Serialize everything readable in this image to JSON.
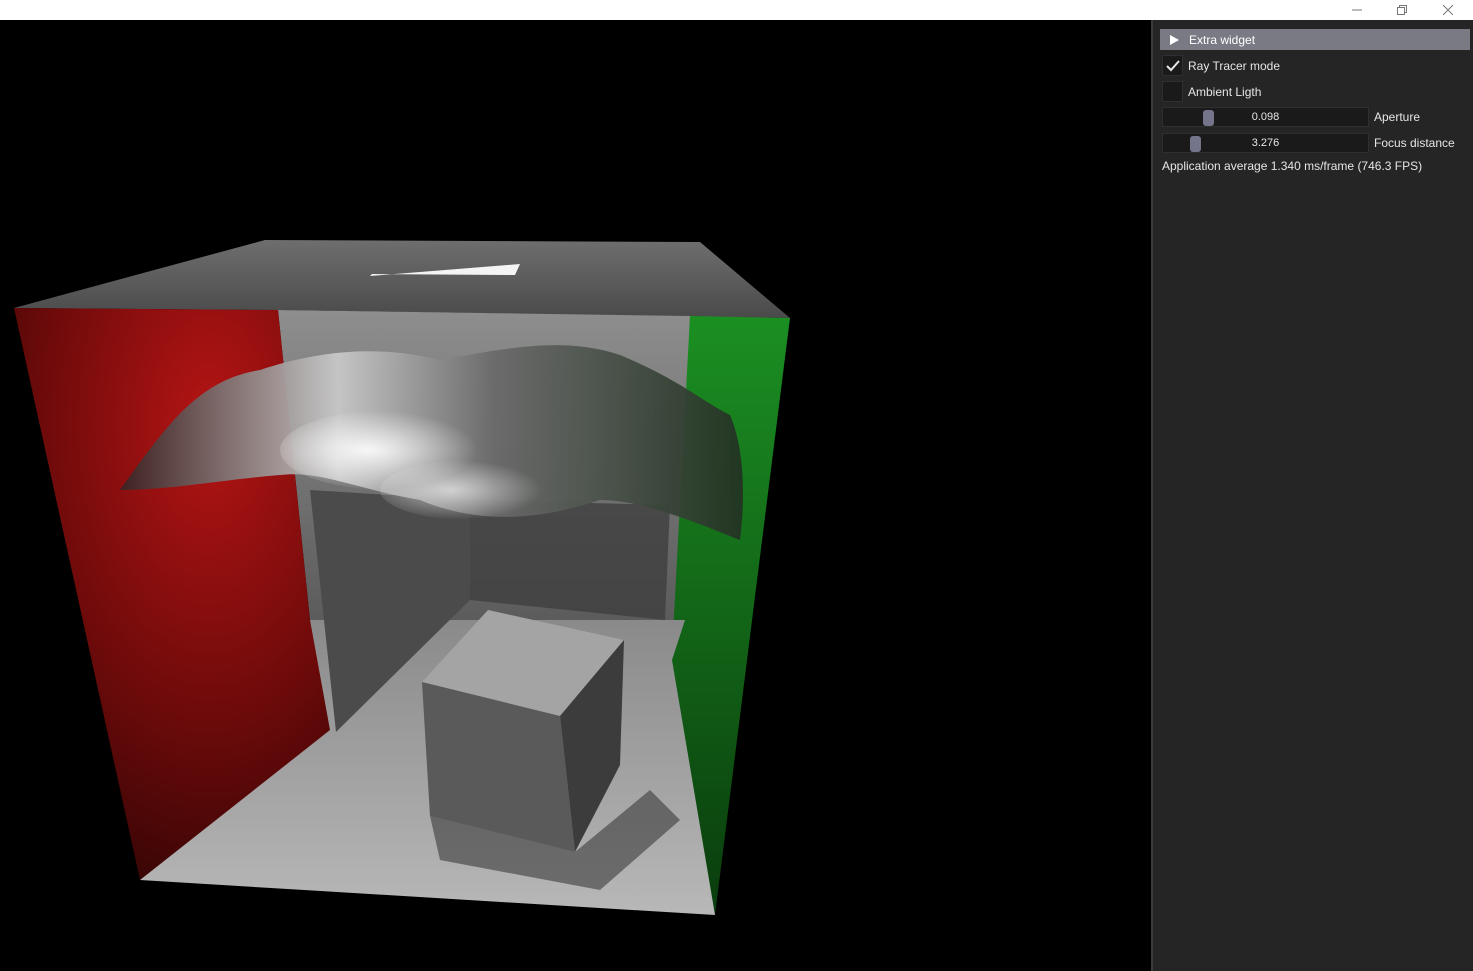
{
  "window": {
    "minimize_label": "minimize",
    "maximize_label": "restore",
    "close_label": "close"
  },
  "panel": {
    "header_label": "Extra widget",
    "ray_tracer": {
      "label": "Ray Tracer mode",
      "checked": true
    },
    "ambient": {
      "label": "Ambient Ligth",
      "checked": false
    },
    "aperture": {
      "value": "0.098",
      "label": "Aperture",
      "fraction": 0.2
    },
    "focus": {
      "value": "3.276",
      "label": "Focus distance",
      "fraction": 0.13
    },
    "stats": "Application average 1.340 ms/frame (746.3 FPS)"
  },
  "scene": {
    "description_icon": "cornell-box-render",
    "colors": {
      "red_wall": "#8a0e0e",
      "green_wall": "#0f6a16",
      "floor": "#9c9c9c",
      "accent": "#7a7a84"
    }
  }
}
